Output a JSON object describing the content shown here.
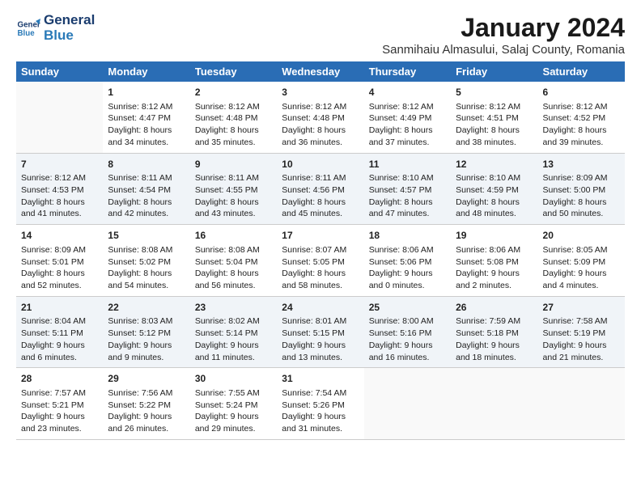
{
  "header": {
    "logo_line1": "General",
    "logo_line2": "Blue",
    "title": "January 2024",
    "subtitle": "Sanmihaiu Almasului, Salaj County, Romania"
  },
  "columns": [
    "Sunday",
    "Monday",
    "Tuesday",
    "Wednesday",
    "Thursday",
    "Friday",
    "Saturday"
  ],
  "weeks": [
    [
      {
        "num": "",
        "lines": []
      },
      {
        "num": "1",
        "lines": [
          "Sunrise: 8:12 AM",
          "Sunset: 4:47 PM",
          "Daylight: 8 hours",
          "and 34 minutes."
        ]
      },
      {
        "num": "2",
        "lines": [
          "Sunrise: 8:12 AM",
          "Sunset: 4:48 PM",
          "Daylight: 8 hours",
          "and 35 minutes."
        ]
      },
      {
        "num": "3",
        "lines": [
          "Sunrise: 8:12 AM",
          "Sunset: 4:48 PM",
          "Daylight: 8 hours",
          "and 36 minutes."
        ]
      },
      {
        "num": "4",
        "lines": [
          "Sunrise: 8:12 AM",
          "Sunset: 4:49 PM",
          "Daylight: 8 hours",
          "and 37 minutes."
        ]
      },
      {
        "num": "5",
        "lines": [
          "Sunrise: 8:12 AM",
          "Sunset: 4:51 PM",
          "Daylight: 8 hours",
          "and 38 minutes."
        ]
      },
      {
        "num": "6",
        "lines": [
          "Sunrise: 8:12 AM",
          "Sunset: 4:52 PM",
          "Daylight: 8 hours",
          "and 39 minutes."
        ]
      }
    ],
    [
      {
        "num": "7",
        "lines": [
          "Sunrise: 8:12 AM",
          "Sunset: 4:53 PM",
          "Daylight: 8 hours",
          "and 41 minutes."
        ]
      },
      {
        "num": "8",
        "lines": [
          "Sunrise: 8:11 AM",
          "Sunset: 4:54 PM",
          "Daylight: 8 hours",
          "and 42 minutes."
        ]
      },
      {
        "num": "9",
        "lines": [
          "Sunrise: 8:11 AM",
          "Sunset: 4:55 PM",
          "Daylight: 8 hours",
          "and 43 minutes."
        ]
      },
      {
        "num": "10",
        "lines": [
          "Sunrise: 8:11 AM",
          "Sunset: 4:56 PM",
          "Daylight: 8 hours",
          "and 45 minutes."
        ]
      },
      {
        "num": "11",
        "lines": [
          "Sunrise: 8:10 AM",
          "Sunset: 4:57 PM",
          "Daylight: 8 hours",
          "and 47 minutes."
        ]
      },
      {
        "num": "12",
        "lines": [
          "Sunrise: 8:10 AM",
          "Sunset: 4:59 PM",
          "Daylight: 8 hours",
          "and 48 minutes."
        ]
      },
      {
        "num": "13",
        "lines": [
          "Sunrise: 8:09 AM",
          "Sunset: 5:00 PM",
          "Daylight: 8 hours",
          "and 50 minutes."
        ]
      }
    ],
    [
      {
        "num": "14",
        "lines": [
          "Sunrise: 8:09 AM",
          "Sunset: 5:01 PM",
          "Daylight: 8 hours",
          "and 52 minutes."
        ]
      },
      {
        "num": "15",
        "lines": [
          "Sunrise: 8:08 AM",
          "Sunset: 5:02 PM",
          "Daylight: 8 hours",
          "and 54 minutes."
        ]
      },
      {
        "num": "16",
        "lines": [
          "Sunrise: 8:08 AM",
          "Sunset: 5:04 PM",
          "Daylight: 8 hours",
          "and 56 minutes."
        ]
      },
      {
        "num": "17",
        "lines": [
          "Sunrise: 8:07 AM",
          "Sunset: 5:05 PM",
          "Daylight: 8 hours",
          "and 58 minutes."
        ]
      },
      {
        "num": "18",
        "lines": [
          "Sunrise: 8:06 AM",
          "Sunset: 5:06 PM",
          "Daylight: 9 hours",
          "and 0 minutes."
        ]
      },
      {
        "num": "19",
        "lines": [
          "Sunrise: 8:06 AM",
          "Sunset: 5:08 PM",
          "Daylight: 9 hours",
          "and 2 minutes."
        ]
      },
      {
        "num": "20",
        "lines": [
          "Sunrise: 8:05 AM",
          "Sunset: 5:09 PM",
          "Daylight: 9 hours",
          "and 4 minutes."
        ]
      }
    ],
    [
      {
        "num": "21",
        "lines": [
          "Sunrise: 8:04 AM",
          "Sunset: 5:11 PM",
          "Daylight: 9 hours",
          "and 6 minutes."
        ]
      },
      {
        "num": "22",
        "lines": [
          "Sunrise: 8:03 AM",
          "Sunset: 5:12 PM",
          "Daylight: 9 hours",
          "and 9 minutes."
        ]
      },
      {
        "num": "23",
        "lines": [
          "Sunrise: 8:02 AM",
          "Sunset: 5:14 PM",
          "Daylight: 9 hours",
          "and 11 minutes."
        ]
      },
      {
        "num": "24",
        "lines": [
          "Sunrise: 8:01 AM",
          "Sunset: 5:15 PM",
          "Daylight: 9 hours",
          "and 13 minutes."
        ]
      },
      {
        "num": "25",
        "lines": [
          "Sunrise: 8:00 AM",
          "Sunset: 5:16 PM",
          "Daylight: 9 hours",
          "and 16 minutes."
        ]
      },
      {
        "num": "26",
        "lines": [
          "Sunrise: 7:59 AM",
          "Sunset: 5:18 PM",
          "Daylight: 9 hours",
          "and 18 minutes."
        ]
      },
      {
        "num": "27",
        "lines": [
          "Sunrise: 7:58 AM",
          "Sunset: 5:19 PM",
          "Daylight: 9 hours",
          "and 21 minutes."
        ]
      }
    ],
    [
      {
        "num": "28",
        "lines": [
          "Sunrise: 7:57 AM",
          "Sunset: 5:21 PM",
          "Daylight: 9 hours",
          "and 23 minutes."
        ]
      },
      {
        "num": "29",
        "lines": [
          "Sunrise: 7:56 AM",
          "Sunset: 5:22 PM",
          "Daylight: 9 hours",
          "and 26 minutes."
        ]
      },
      {
        "num": "30",
        "lines": [
          "Sunrise: 7:55 AM",
          "Sunset: 5:24 PM",
          "Daylight: 9 hours",
          "and 29 minutes."
        ]
      },
      {
        "num": "31",
        "lines": [
          "Sunrise: 7:54 AM",
          "Sunset: 5:26 PM",
          "Daylight: 9 hours",
          "and 31 minutes."
        ]
      },
      {
        "num": "",
        "lines": []
      },
      {
        "num": "",
        "lines": []
      },
      {
        "num": "",
        "lines": []
      }
    ]
  ]
}
